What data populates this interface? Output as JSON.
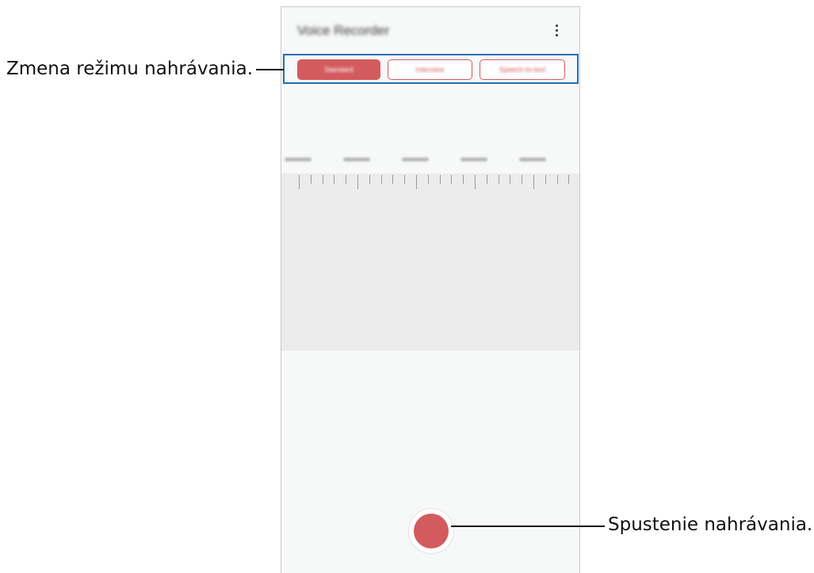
{
  "app": {
    "title": "Voice Recorder",
    "menu_icon": "more-vert-icon"
  },
  "mode_tabs": [
    {
      "label": "Standard",
      "selected": true
    },
    {
      "label": "Interview",
      "selected": false
    },
    {
      "label": "Speech-to-text",
      "selected": false
    }
  ],
  "timeline": {
    "labels": [
      "00:00",
      "00:05",
      "00:10",
      "00:15",
      "00:20"
    ]
  },
  "record_button": {
    "icon": "record-icon",
    "color": "#d35b5e"
  },
  "callouts": {
    "mode": "Zmena režimu nahrávania.",
    "record": "Spustenie nahrávania."
  },
  "colors": {
    "accent": "#d35b5e",
    "highlight_border": "#1f6fb2"
  }
}
